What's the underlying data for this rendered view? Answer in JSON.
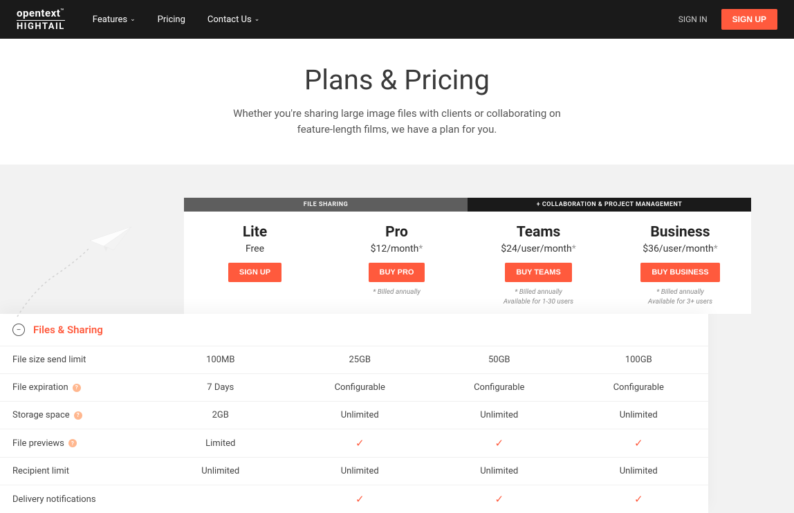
{
  "header": {
    "logo_top": "opentext",
    "logo_bottom": "HIGHTAIL",
    "nav": [
      "Features",
      "Pricing",
      "Contact Us"
    ],
    "signin": "SIGN IN",
    "signup": "SIGN UP"
  },
  "hero": {
    "title": "Plans & Pricing",
    "subtitle": "Whether you're sharing large image files with clients or collaborating on feature-length films, we have a plan for you."
  },
  "categories": {
    "left": "FILE SHARING",
    "right": "+ COLLABORATION & PROJECT MANAGEMENT"
  },
  "plans": [
    {
      "name": "Lite",
      "price": "Free",
      "cta": "SIGN UP",
      "note1": "",
      "note2": ""
    },
    {
      "name": "Pro",
      "price": "$12/month",
      "cta": "BUY PRO",
      "note1": "* Billed annually",
      "note2": ""
    },
    {
      "name": "Teams",
      "price": "$24/user/month",
      "cta": "BUY TEAMS",
      "note1": "* Billed annually",
      "note2": "Available for 1-30 users"
    },
    {
      "name": "Business",
      "price": "$36/user/month",
      "cta": "BUY BUSINESS",
      "note1": "* Billed annually",
      "note2": "Available for 3+ users"
    }
  ],
  "section": {
    "title": "Files & Sharing"
  },
  "features": [
    {
      "label": "File size send limit",
      "help": false,
      "vals": [
        "100MB",
        "25GB",
        "50GB",
        "100GB"
      ]
    },
    {
      "label": "File expiration",
      "help": true,
      "vals": [
        "7 Days",
        "Configurable",
        "Configurable",
        "Configurable"
      ]
    },
    {
      "label": "Storage space",
      "help": true,
      "vals": [
        "2GB",
        "Unlimited",
        "Unlimited",
        "Unlimited"
      ]
    },
    {
      "label": "File previews",
      "help": true,
      "vals": [
        "Limited",
        "✓",
        "✓",
        "✓"
      ]
    },
    {
      "label": "Recipient limit",
      "help": false,
      "vals": [
        "Unlimited",
        "Unlimited",
        "Unlimited",
        "Unlimited"
      ]
    },
    {
      "label": "Delivery notifications",
      "help": false,
      "vals": [
        "",
        "✓",
        "✓",
        "✓"
      ]
    }
  ]
}
